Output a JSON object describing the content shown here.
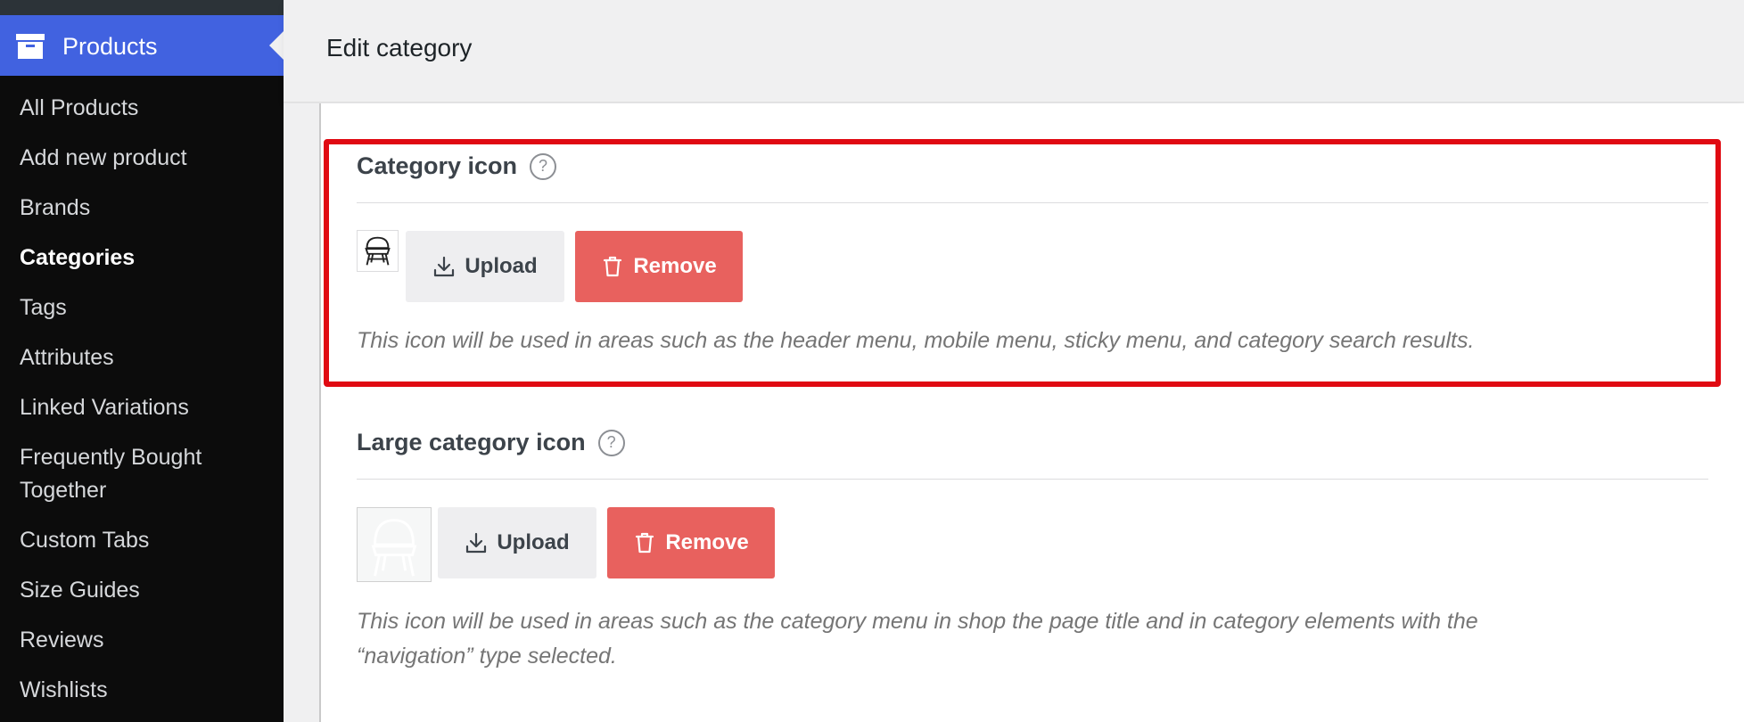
{
  "sidebar": {
    "header": {
      "title": "Products",
      "icon": "archive-box-icon"
    },
    "items": [
      {
        "label": "All Products",
        "active": false
      },
      {
        "label": "Add new product",
        "active": false
      },
      {
        "label": "Brands",
        "active": false
      },
      {
        "label": "Categories",
        "active": true
      },
      {
        "label": "Tags",
        "active": false
      },
      {
        "label": "Attributes",
        "active": false
      },
      {
        "label": "Linked Variations",
        "active": false
      },
      {
        "label": "Frequently Bought Together",
        "active": false
      },
      {
        "label": "Custom Tabs",
        "active": false
      },
      {
        "label": "Size Guides",
        "active": false
      },
      {
        "label": "Reviews",
        "active": false
      },
      {
        "label": "Wishlists",
        "active": false
      }
    ]
  },
  "topbar": {
    "page_title": "Edit category"
  },
  "category_icon": {
    "title": "Category icon",
    "help": "?",
    "upload_label": "Upload",
    "remove_label": "Remove",
    "description": "This icon will be used in areas such as the header menu, mobile menu, sticky menu, and category search results."
  },
  "large_category_icon": {
    "title": "Large category icon",
    "help": "?",
    "upload_label": "Upload",
    "remove_label": "Remove",
    "description_line1": "This icon will be used in areas such as the category menu in shop the page title and in category elements with the",
    "description_line2": "“navigation” type selected."
  },
  "colors": {
    "sidebar_bg": "#0c0c0c",
    "sidebar_accent": "#4162e0",
    "remove_button": "#e8615e",
    "highlight_border": "#e00a12"
  }
}
